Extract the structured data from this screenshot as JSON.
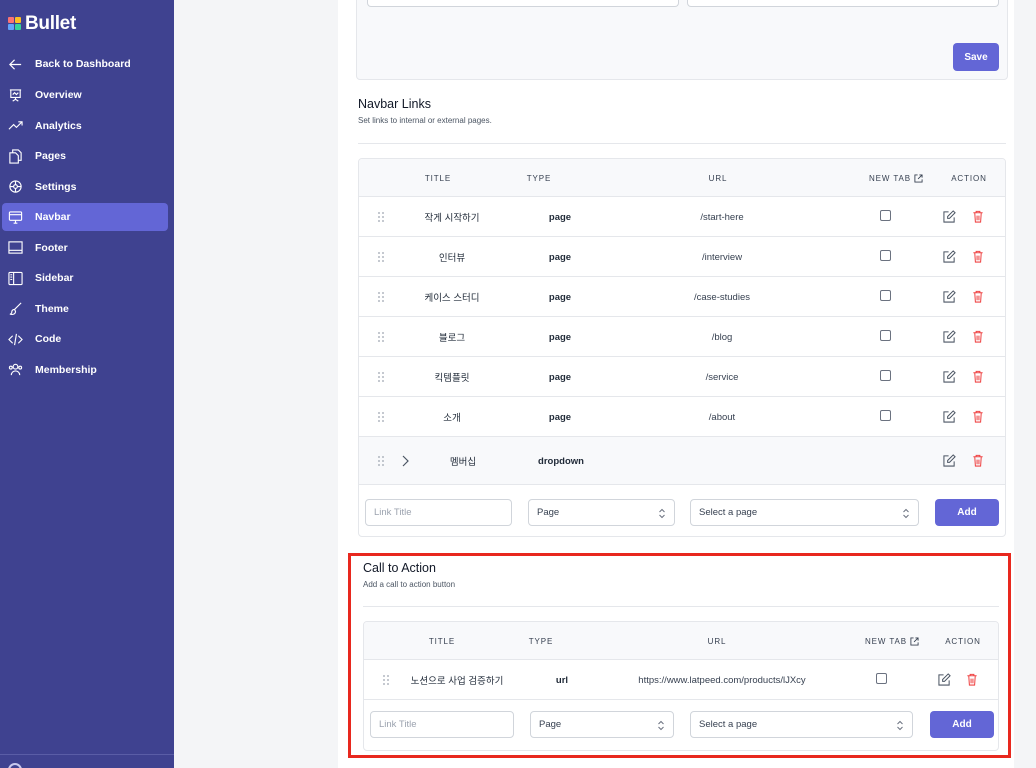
{
  "app": {
    "name": "Bullet"
  },
  "sidebar": {
    "back": {
      "label": "Back to Dashboard",
      "icon": "arrow-left-icon"
    },
    "items": [
      {
        "label": "Overview",
        "icon": "presentation-icon",
        "active": false
      },
      {
        "label": "Analytics",
        "icon": "trending-up-icon",
        "active": false
      },
      {
        "label": "Pages",
        "icon": "pages-icon",
        "active": false
      },
      {
        "label": "Settings",
        "icon": "gear-icon",
        "active": false
      },
      {
        "label": "Navbar",
        "icon": "monitor-icon",
        "active": true
      },
      {
        "label": "Footer",
        "icon": "footer-icon",
        "active": false
      },
      {
        "label": "Sidebar",
        "icon": "sidebar-icon",
        "active": false
      },
      {
        "label": "Theme",
        "icon": "brush-icon",
        "active": false
      },
      {
        "label": "Code",
        "icon": "code-icon",
        "active": false
      },
      {
        "label": "Membership",
        "icon": "users-icon",
        "active": false
      }
    ]
  },
  "settings": {
    "save_label": "Save"
  },
  "navbar_links": {
    "title": "Navbar Links",
    "subtitle": "Set links to internal or external pages.",
    "headers": {
      "title": "TITLE",
      "type": "TYPE",
      "url": "URL",
      "new_tab": "NEW TAB",
      "action": "ACTION"
    },
    "rows": [
      {
        "title": "작게 시작하기",
        "type": "page",
        "url": "/start-here"
      },
      {
        "title": "인터뷰",
        "type": "page",
        "url": "/interview"
      },
      {
        "title": "케이스 스터디",
        "type": "page",
        "url": "/case-studies"
      },
      {
        "title": "블로그",
        "type": "page",
        "url": "/blog"
      },
      {
        "title": "킥템플릿",
        "type": "page",
        "url": "/service"
      },
      {
        "title": "소개",
        "type": "page",
        "url": "/about"
      },
      {
        "title": "멤버십",
        "type": "dropdown",
        "url": ""
      }
    ],
    "form": {
      "title_placeholder": "Link Title",
      "type_value": "Page",
      "page_value": "Select a page",
      "add_label": "Add"
    }
  },
  "cta": {
    "title": "Call to Action",
    "subtitle": "Add a call to action button",
    "headers": {
      "title": "TITLE",
      "type": "TYPE",
      "url": "URL",
      "new_tab": "NEW TAB",
      "action": "ACTION"
    },
    "rows": [
      {
        "title": "노션으로 사업 검증하기",
        "type": "url",
        "url": "https://www.latpeed.com/products/lJXcy"
      }
    ],
    "form": {
      "title_placeholder": "Link Title",
      "type_value": "Page",
      "page_value": "Select a page",
      "add_label": "Add"
    }
  },
  "colors": {
    "sidebar": "#3f4290",
    "accent": "#6366d6",
    "danger": "#ef4444",
    "highlight": "#e8281e"
  }
}
